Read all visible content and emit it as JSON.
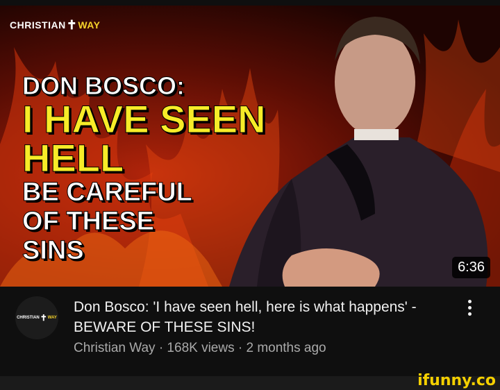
{
  "thumbnail": {
    "brand_word1": "CHRISTIAN",
    "brand_cross": "✝",
    "brand_word2": "WAY",
    "headline_line1": "DON BOSCO:",
    "headline_line2": "I HAVE SEEN",
    "headline_line3": "HELL",
    "headline_line4": "BE CAREFUL",
    "headline_line5": "OF THESE",
    "headline_line6": "SINS",
    "duration": "6:36"
  },
  "video": {
    "title": "Don Bosco: 'I have seen hell, here is what happens' - BEWARE OF THESE SINS!",
    "meta": "Christian Way · 168K views · 2 months ago"
  },
  "avatar": {
    "word1": "CHRISTIAN",
    "cross": "✝",
    "word2": "WAY"
  },
  "watermark": "ifunny.co",
  "colors": {
    "background": "#0f0f0f",
    "headline_yellow": "#f7ec28",
    "brand_yellow": "#f6d32a",
    "meta_gray": "#aaaaaa"
  }
}
